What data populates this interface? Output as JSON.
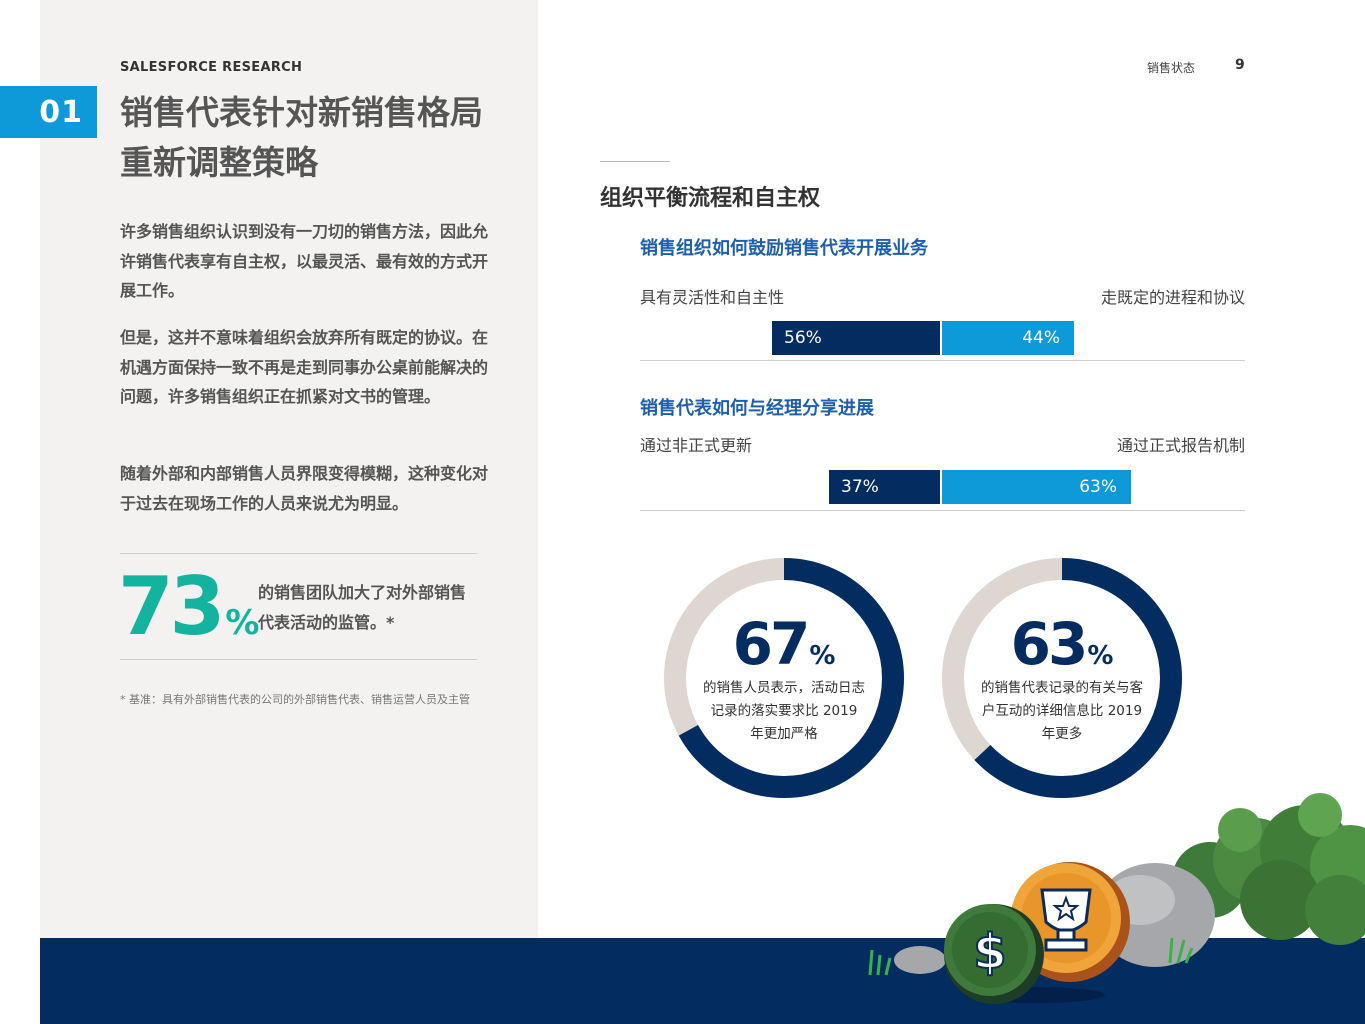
{
  "header": {
    "brand": "SALESFORCE RESEARCH",
    "chapter": "01",
    "title": "销售代表针对新销售格局重新调整策略",
    "section": "销售状态",
    "page": "9"
  },
  "body": {
    "paragraphs": [
      "许多销售组织认识到没有一刀切的销售方法，因此允许销售代表享有自主权，以最灵活、最有效的方式开展工作。",
      "但是，这并不意味着组织会放弃所有既定的协议。在机遇方面保持一致不再是走到同事办公桌前能解决的问题，许多销售组织正在抓紧对文书的管理。",
      "随着外部和内部销售人员界限变得模糊，这种变化对于过去在现场工作的人员来说尤为明显。"
    ],
    "stat": {
      "value": "73",
      "unit": "%",
      "text": "的销售团队加大了对外部销售代表活动的监管。*"
    },
    "footnote": "* 基准：具有外部销售代表的公司的外部销售代表、销售运营人员及主管"
  },
  "section_title": "组织平衡流程和自主权",
  "chart_data": [
    {
      "type": "bar",
      "title": "销售组织如何鼓励销售代表开展业务",
      "series": [
        {
          "name": "具有灵活性和自主性",
          "values": [
            56
          ],
          "label": "56%"
        },
        {
          "name": "走既定的进程和协议",
          "values": [
            44
          ],
          "label": "44%"
        }
      ]
    },
    {
      "type": "bar",
      "title": "销售代表如何与经理分享进展",
      "series": [
        {
          "name": "通过非正式更新",
          "values": [
            37
          ],
          "label": "37%"
        },
        {
          "name": "通过正式报告机制",
          "values": [
            63
          ],
          "label": "63%"
        }
      ]
    },
    {
      "type": "pie",
      "value": 67,
      "number": "67",
      "unit": "%",
      "text": "的销售人员表示，活动日志记录的落实要求比 2019 年更加严格"
    },
    {
      "type": "pie",
      "value": 63,
      "number": "63",
      "unit": "%",
      "text": "的销售代表记录的有关与客户互动的详细信息比 2019 年更多"
    }
  ],
  "colors": {
    "navy": "#032d60",
    "blue": "#0e9ad8",
    "teal": "#14b3a0",
    "subtitle": "#1f5fa8",
    "ring_bg": "#ddd6d1"
  },
  "icons": [
    "dollar-coin-icon",
    "trophy-coin-icon"
  ]
}
